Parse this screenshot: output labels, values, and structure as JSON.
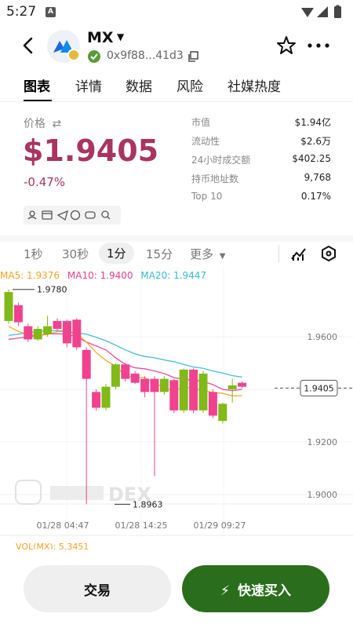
{
  "status_bar": {
    "time": "5:27",
    "a_icon": "A"
  },
  "header": {
    "token_name": "MX",
    "address": "0x9f88...41d3"
  },
  "tabs": [
    {
      "label": "图表"
    },
    {
      "label": "详情"
    },
    {
      "label": "数据"
    },
    {
      "label": "风险"
    },
    {
      "label": "社媒热度"
    }
  ],
  "price": {
    "label": "价格",
    "value": "$1.9405",
    "change": "-0.47%"
  },
  "stats": [
    {
      "label": "市值",
      "value": "$1.94亿"
    },
    {
      "label": "流动性",
      "value": "$2.6万"
    },
    {
      "label": "24小时成交额",
      "value": "$402.25"
    },
    {
      "label": "持币地址数",
      "value": "9,768"
    },
    {
      "label": "Top 10",
      "value": "0.17%"
    }
  ],
  "intervals": [
    {
      "label": "1秒"
    },
    {
      "label": "30秒"
    },
    {
      "label": "1分"
    },
    {
      "label": "15分"
    },
    {
      "label": "更多"
    }
  ],
  "ma_legend": {
    "ma5": "MA5: 1.9376",
    "ma10": "MA10: 1.9400",
    "ma20": "MA20: 1.9447"
  },
  "chart_data": {
    "type": "candlestick",
    "y_ticks": [
      "1.9600",
      "1.9400",
      "1.9200",
      "1.9000"
    ],
    "x_ticks": [
      "01/28 04:47",
      "01/28 14:25",
      "01/29 09:27"
    ],
    "current_price": "1.9405",
    "high_label": "1.9780",
    "low_label": "1.8963",
    "watermark": "DEX",
    "colors": {
      "up": "#80b918",
      "down": "#f0428f",
      "ma5": "#f5a323",
      "ma10": "#e83e8c",
      "ma20": "#36b8d6"
    },
    "candles": [
      {
        "o": 1.966,
        "h": 1.978,
        "l": 1.965,
        "c": 1.977
      },
      {
        "o": 1.972,
        "h": 1.973,
        "l": 1.964,
        "c": 1.9655
      },
      {
        "o": 1.964,
        "h": 1.965,
        "l": 1.958,
        "c": 1.959
      },
      {
        "o": 1.959,
        "h": 1.964,
        "l": 1.9585,
        "c": 1.963
      },
      {
        "o": 1.961,
        "h": 1.968,
        "l": 1.96,
        "c": 1.964
      },
      {
        "o": 1.966,
        "h": 1.967,
        "l": 1.962,
        "c": 1.963
      },
      {
        "o": 1.966,
        "h": 1.9665,
        "l": 1.956,
        "c": 1.9575
      },
      {
        "o": 1.9665,
        "h": 1.967,
        "l": 1.955,
        "c": 1.956
      },
      {
        "o": 1.955,
        "h": 1.956,
        "l": 1.8963,
        "c": 1.944
      },
      {
        "o": 1.939,
        "h": 1.94,
        "l": 1.932,
        "c": 1.933
      },
      {
        "o": 1.933,
        "h": 1.942,
        "l": 1.932,
        "c": 1.941
      },
      {
        "o": 1.941,
        "h": 1.95,
        "l": 1.94,
        "c": 1.9495
      },
      {
        "o": 1.9495,
        "h": 1.95,
        "l": 1.943,
        "c": 1.944
      },
      {
        "o": 1.946,
        "h": 1.947,
        "l": 1.942,
        "c": 1.9425
      },
      {
        "o": 1.944,
        "h": 1.945,
        "l": 1.937,
        "c": 1.939
      },
      {
        "o": 1.944,
        "h": 1.945,
        "l": 1.907,
        "c": 1.939
      },
      {
        "o": 1.939,
        "h": 1.945,
        "l": 1.938,
        "c": 1.944
      },
      {
        "o": 1.9435,
        "h": 1.944,
        "l": 1.931,
        "c": 1.932
      },
      {
        "o": 1.932,
        "h": 1.948,
        "l": 1.931,
        "c": 1.9475
      },
      {
        "o": 1.9475,
        "h": 1.948,
        "l": 1.931,
        "c": 1.932
      },
      {
        "o": 1.932,
        "h": 1.947,
        "l": 1.931,
        "c": 1.946
      },
      {
        "o": 1.939,
        "h": 1.94,
        "l": 1.929,
        "c": 1.93
      },
      {
        "o": 1.928,
        "h": 1.935,
        "l": 1.927,
        "c": 1.9345
      },
      {
        "o": 1.94,
        "h": 1.944,
        "l": 1.935,
        "c": 1.9415
      },
      {
        "o": 1.9425,
        "h": 1.943,
        "l": 1.9405,
        "c": 1.941
      }
    ],
    "ma5": [
      1.964,
      1.962,
      1.961,
      1.9605,
      1.9608,
      1.962,
      1.962,
      1.961,
      1.958,
      1.954,
      1.951,
      1.9488,
      1.9452,
      1.9445,
      1.9445,
      1.9425,
      1.9405,
      1.9395,
      1.9408,
      1.9405,
      1.9395,
      1.9388,
      1.9385,
      1.9375,
      1.9376
    ],
    "ma10": [
      1.959,
      1.9595,
      1.96,
      1.9605,
      1.961,
      1.9612,
      1.961,
      1.96,
      1.958,
      1.9565,
      1.955,
      1.952,
      1.9495,
      1.9482,
      1.9478,
      1.947,
      1.946,
      1.9445,
      1.9438,
      1.9435,
      1.943,
      1.9418,
      1.94,
      1.9395,
      1.94
    ],
    "ma20": [
      1.9605,
      1.961,
      1.9615,
      1.962,
      1.9622,
      1.9624,
      1.962,
      1.9615,
      1.961,
      1.9598,
      1.9585,
      1.9568,
      1.955,
      1.9535,
      1.9525,
      1.952,
      1.9512,
      1.9505,
      1.9495,
      1.9485,
      1.948,
      1.947,
      1.9462,
      1.9452,
      1.9447
    ]
  },
  "volume": {
    "label": "VOL(MX): 5.3451"
  },
  "actions": {
    "trade_label": "交易",
    "buy_label": "快速买入"
  }
}
